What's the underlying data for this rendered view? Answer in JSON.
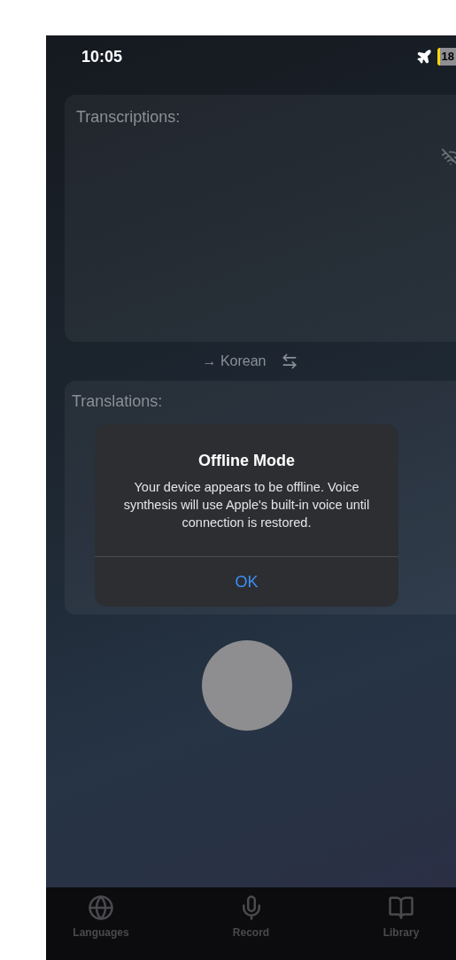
{
  "status_bar": {
    "time": "10:05",
    "battery": "18"
  },
  "transcriptions": {
    "label": "Transcriptions:"
  },
  "language_bar": {
    "target": "→ Korean"
  },
  "translations": {
    "label": "Translations:"
  },
  "alert": {
    "title": "Offline Mode",
    "message": "Your device appears to be offline. Voice synthesis will use Apple's built-in voice until connection is restored.",
    "button": "OK"
  },
  "tab_bar": [
    {
      "label": "Languages",
      "kind": "globe",
      "selected": false
    },
    {
      "label": "Record",
      "kind": "mic",
      "selected": false
    },
    {
      "label": "Library",
      "kind": "book",
      "selected": false
    }
  ]
}
